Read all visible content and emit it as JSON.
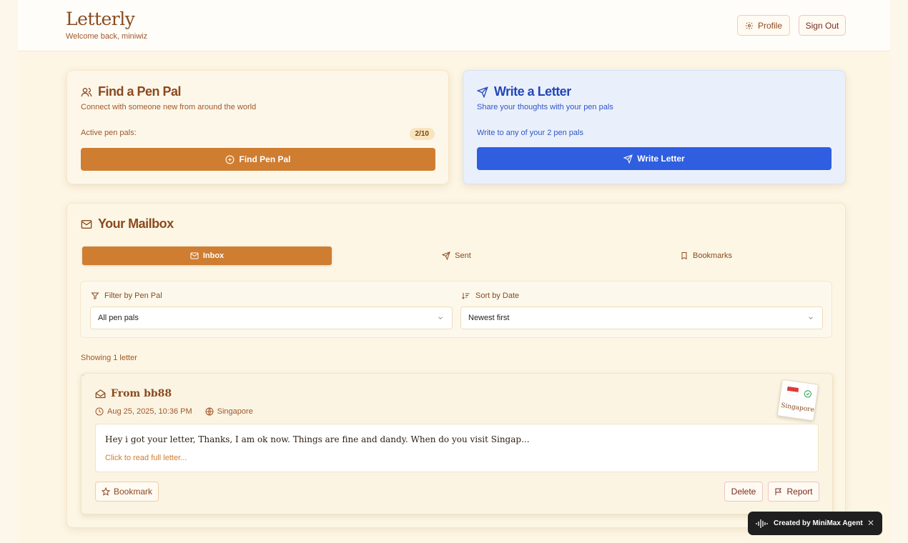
{
  "app": {
    "title": "Letterly",
    "welcome": "Welcome back, miniwiz"
  },
  "header": {
    "profile_label": "Profile",
    "signout_label": "Sign Out"
  },
  "find_pal": {
    "title": "Find a Pen Pal",
    "description": "Connect with someone new from around the world",
    "active_label": "Active pen pals:",
    "active_count": "2/10",
    "button_label": "Find Pen Pal"
  },
  "write_letter": {
    "title": "Write a Letter",
    "description": "Share your thoughts with your pen pals",
    "info": "Write to any of your 2 pen pals",
    "button_label": "Write Letter"
  },
  "mailbox": {
    "title": "Your Mailbox",
    "tabs": [
      {
        "label": "Inbox",
        "active": true
      },
      {
        "label": "Sent",
        "active": false
      },
      {
        "label": "Bookmarks",
        "active": false
      }
    ],
    "filter_label": "Filter by Pen Pal",
    "filter_value": "All pen pals",
    "sort_label": "Sort by Date",
    "sort_value": "Newest first",
    "showing": "Showing 1 letter",
    "letters": [
      {
        "from": "From bb88",
        "date": "Aug 25, 2025, 10:36 PM",
        "location": "Singapore",
        "stamp_city": "Singapore",
        "excerpt": "Hey i got your letter, Thanks, I am ok now. Things are fine and dandy. When do you visit Singap...",
        "read_more": "Click to read full letter...",
        "bookmark_label": "Bookmark",
        "delete_label": "Delete",
        "report_label": "Report"
      }
    ]
  },
  "toast": {
    "label": "Created by MiniMax Agent"
  },
  "colors": {
    "accent": "#cf7d31",
    "blue": "#2f5ee0",
    "brown": "#8a4a1f"
  }
}
